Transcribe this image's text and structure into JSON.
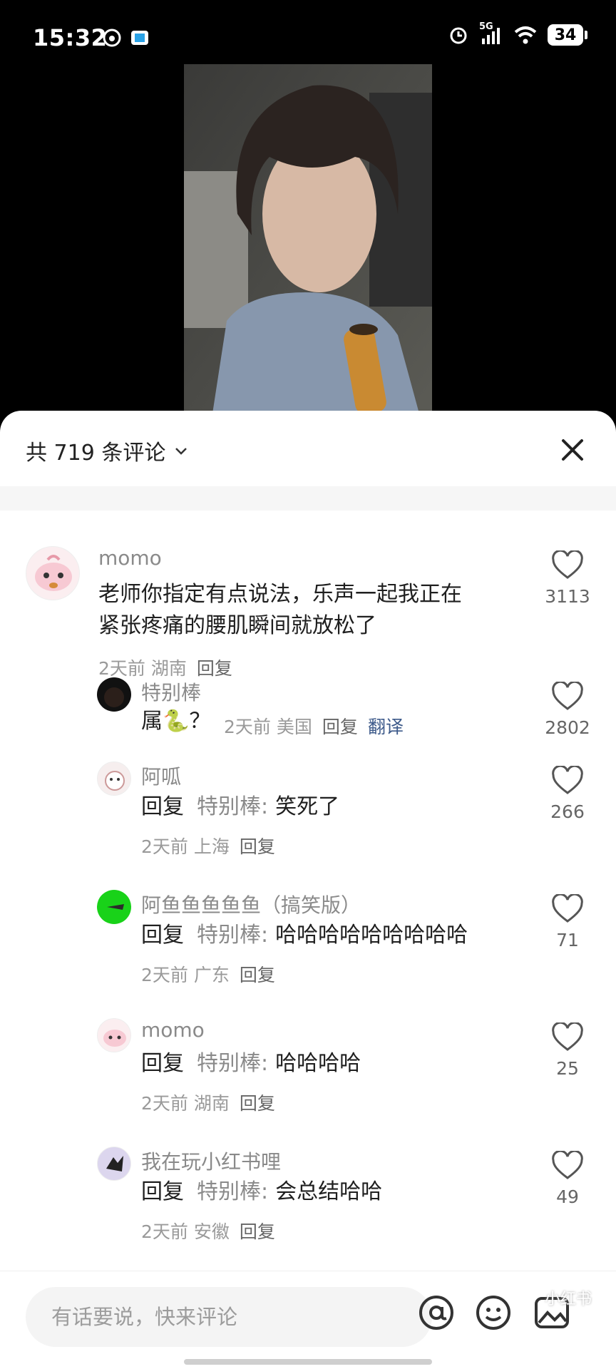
{
  "status_bar": {
    "time": "15:32",
    "network": "5G",
    "battery": "34"
  },
  "sheet": {
    "title": "共 719 条评论"
  },
  "comments": [
    {
      "user": "momo",
      "text_lines": [
        "老师你指定有点说法，乐声一起我正在",
        "紧张疼痛的腰肌瞬间就放松了"
      ],
      "time": "2天前",
      "location": "湖南",
      "reply_label": "回复",
      "likes": "3113"
    }
  ],
  "replies": [
    {
      "user": "特别棒",
      "text": "属🐍？",
      "time": "2天前",
      "location": "美国",
      "reply_label": "回复",
      "translate_label": "翻译",
      "likes": "2802"
    },
    {
      "user": "阿呱",
      "reply_prefix": "回复",
      "reply_to": "特别棒:",
      "text": "笑死了",
      "time": "2天前",
      "location": "上海",
      "reply_label": "回复",
      "likes": "266"
    },
    {
      "user": "阿鱼鱼鱼鱼鱼（搞笑版）",
      "reply_prefix": "回复",
      "reply_to": "特别棒:",
      "text": "哈哈哈哈哈哈哈哈哈",
      "time": "2天前",
      "location": "广东",
      "reply_label": "回复",
      "likes": "71"
    },
    {
      "user": "momo",
      "reply_prefix": "回复",
      "reply_to": "特别棒:",
      "text": "哈哈哈哈",
      "time": "2天前",
      "location": "湖南",
      "reply_label": "回复",
      "likes": "25"
    },
    {
      "user": "我在玩小红书哩",
      "reply_prefix": "回复",
      "reply_to": "特别棒:",
      "text": "会总结哈哈",
      "time": "2天前",
      "location": "安徽",
      "reply_label": "回复",
      "likes": "49"
    }
  ],
  "bottom_bar": {
    "placeholder": "有话要说，快来评论",
    "icons": [
      "at-icon",
      "emoji-icon",
      "image-icon"
    ]
  },
  "watermark": "小红书",
  "colors": {
    "accent_translate": "#3d5a8a",
    "text_primary": "#1f1f1f",
    "text_secondary": "#8a8a8a"
  }
}
